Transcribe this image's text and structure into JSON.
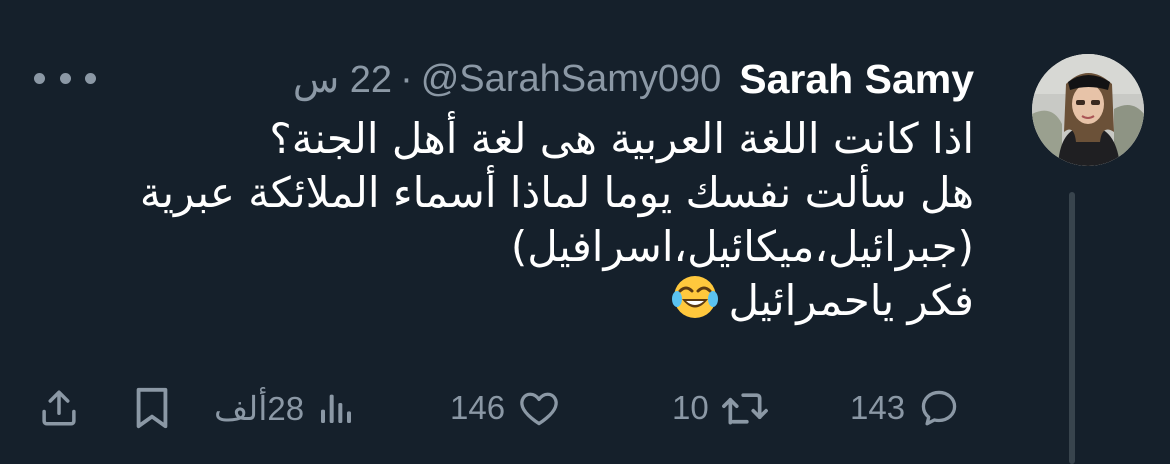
{
  "tweet": {
    "author_name": "Sarah Samy",
    "handle": "@SarahSamy090",
    "separator": "·",
    "time": "22 س",
    "lines": [
      "اذا كانت اللغة العربية هى لغة أهل الجنة؟",
      "هل سألت نفسك يوما لماذا أسماء الملائكة عبرية",
      "(جبرائيل،ميكائيل،اسرافيل)",
      "فكر ياحمرائيل"
    ],
    "emoji": "face-with-tears-of-joy"
  },
  "actions": {
    "replies": "143",
    "retweets": "10",
    "likes": "146",
    "views": "28ألف"
  },
  "colors": {
    "background": "#15202b",
    "text": "#ffffff",
    "muted": "#8b98a5",
    "thread_line": "#38444d"
  },
  "icons": {
    "more": "more-horizontal-icon",
    "reply": "reply-icon",
    "retweet": "retweet-icon",
    "like": "heart-icon",
    "views": "views-chart-icon",
    "bookmark": "bookmark-icon",
    "share": "share-icon"
  }
}
